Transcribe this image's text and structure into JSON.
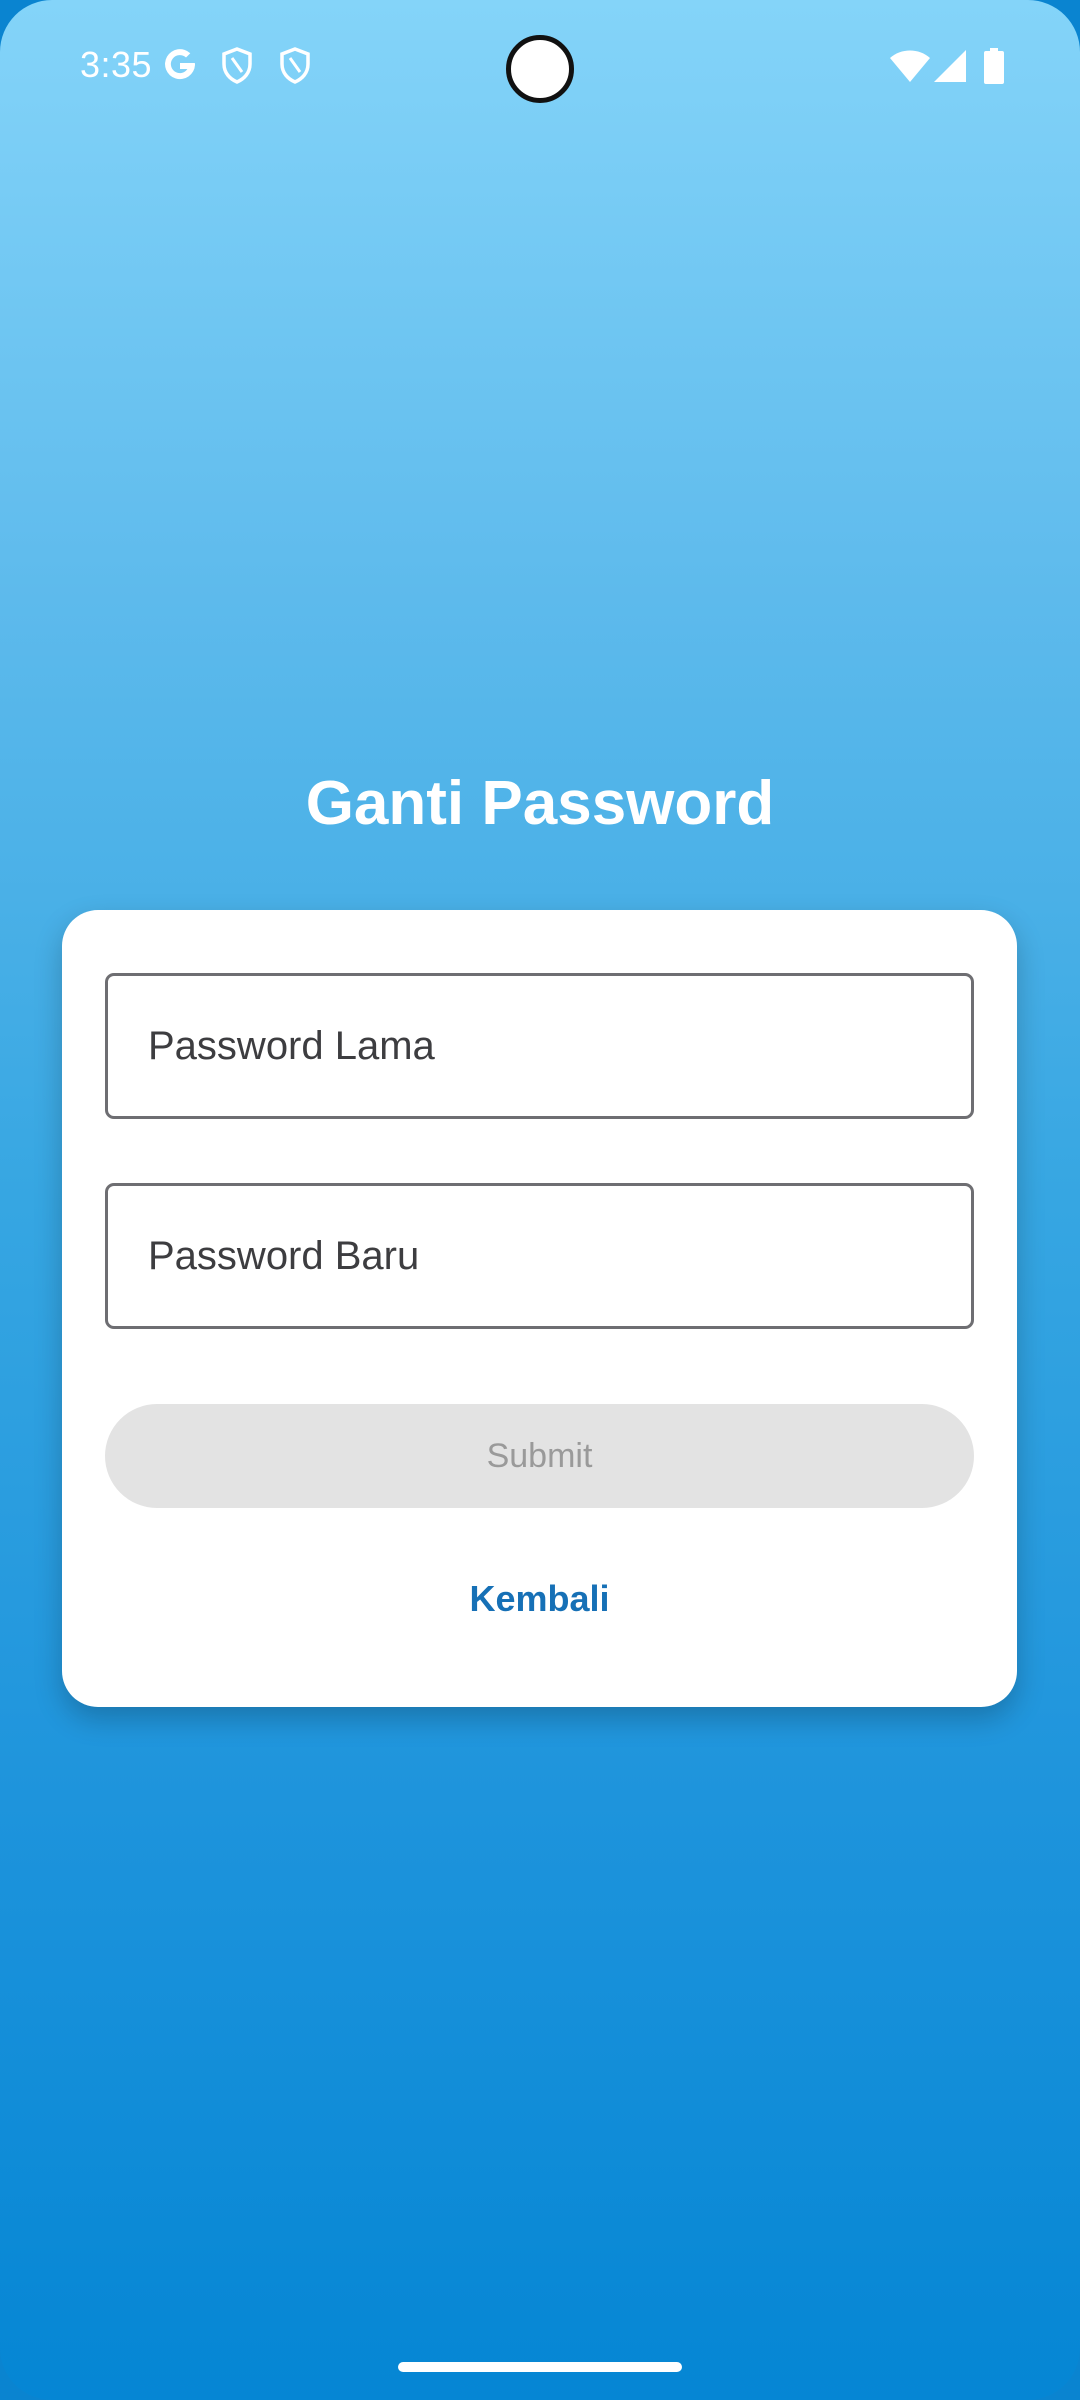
{
  "status_bar": {
    "time": "3:35",
    "left_icons": [
      "google-icon",
      "shield-icon",
      "shield-icon"
    ],
    "right_icons": [
      "wifi-icon",
      "signal-icon",
      "battery-icon"
    ]
  },
  "page": {
    "title": "Ganti Password"
  },
  "form": {
    "old_password_placeholder": "Password Lama",
    "new_password_placeholder": "Password Baru",
    "submit_label": "Submit",
    "back_label": "Kembali"
  },
  "colors": {
    "gradient_top": "#84d4f9",
    "gradient_bottom": "#0586d4",
    "link": "#1670b6",
    "button_disabled_bg": "#e3e3e3",
    "button_disabled_text": "#9a9a9a"
  }
}
